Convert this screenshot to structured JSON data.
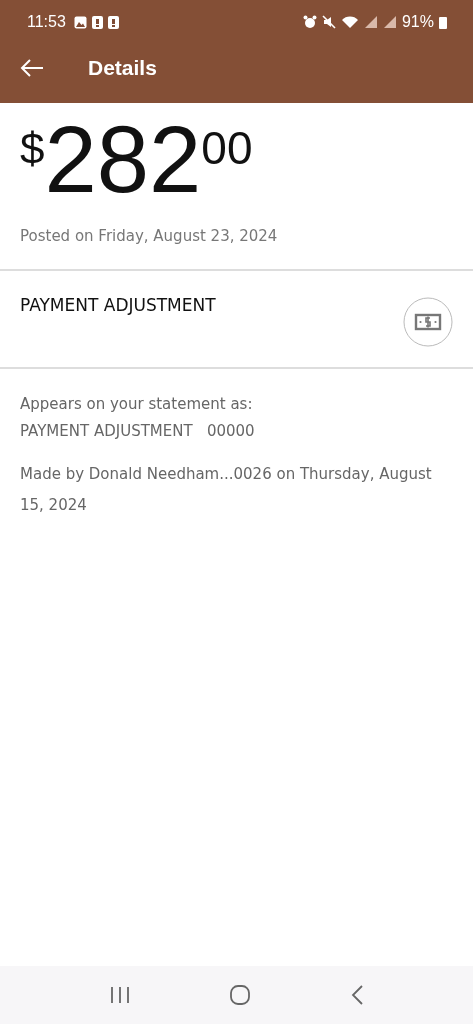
{
  "status_bar": {
    "time": "11:53",
    "battery": "91%"
  },
  "app_bar": {
    "title": "Details"
  },
  "amount": {
    "currency": "$",
    "whole": "282",
    "cents": "00"
  },
  "posted": "Posted on Friday, August 23, 2024",
  "transaction": {
    "label": "PAYMENT ADJUSTMENT"
  },
  "statement": {
    "intro": "Appears on your statement as:",
    "text": "PAYMENT ADJUSTMENT   00000"
  },
  "made_by": "Made by Donald Needham...0026 on Thursday, August 15, 2024"
}
